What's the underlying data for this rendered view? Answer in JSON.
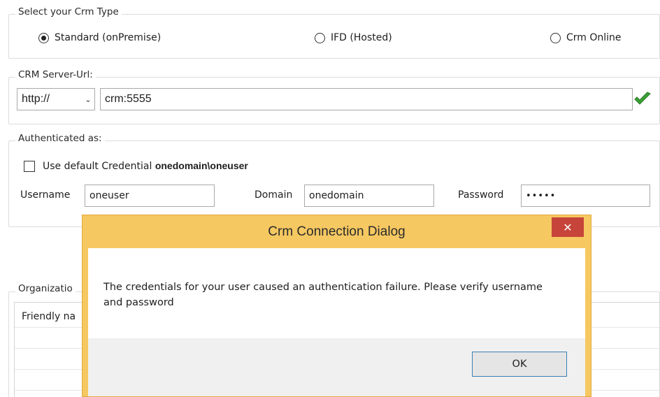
{
  "crm_type": {
    "legend": "Select your Crm Type",
    "options": [
      {
        "label": "Standard (onPremise)",
        "selected": true
      },
      {
        "label": "IFD (Hosted)",
        "selected": false
      },
      {
        "label": "Crm Online",
        "selected": false
      }
    ]
  },
  "server_url": {
    "legend": "CRM Server-Url:",
    "protocol": "http://",
    "url": "crm:5555"
  },
  "auth": {
    "legend": "Authenticated as:",
    "use_default_prefix": "Use default Credential",
    "use_default_user": "onedomain\\oneuser",
    "use_default_checked": false,
    "username_label": "Username",
    "username_value": "oneuser",
    "domain_label": "Domain",
    "domain_value": "onedomain",
    "password_label": "Password",
    "password_value": "•••••"
  },
  "organization": {
    "legend": "Organizatio",
    "column_friendly": "Friendly na"
  },
  "dialog": {
    "title": "Crm Connection Dialog",
    "close_glyph": "✕",
    "message": "The credentials for your user caused an authentication failure. Please verify username and password",
    "ok_label": "OK"
  },
  "colors": {
    "dialog_frame": "#f6c861",
    "close_button": "#c7443a",
    "check_green": "#3aa035"
  }
}
